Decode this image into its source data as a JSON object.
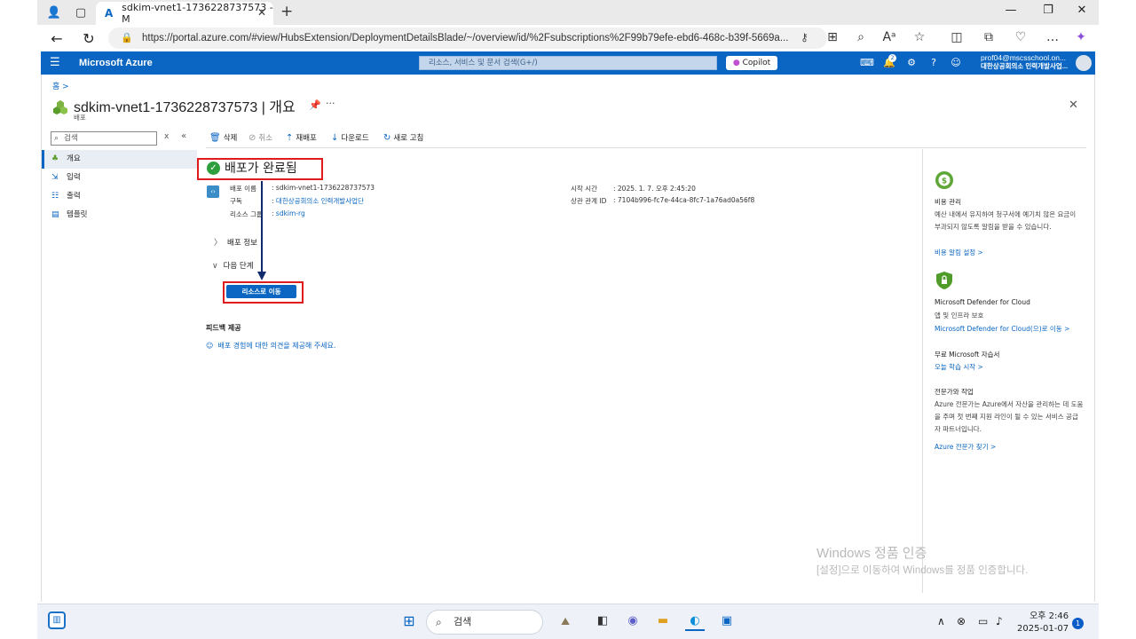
{
  "browser": {
    "tab_title": "sdkim-vnet1-1736228737573 - M",
    "url": "https://portal.azure.com/#view/HubsExtension/DeploymentDetailsBlade/~/overview/id/%2Fsubscriptions%2F99b79efe-ebd6-468c-b39f-5669a..."
  },
  "azure_header": {
    "brand": "Microsoft Azure",
    "search_placeholder": "리소스, 서비스 및 문서 검색(G+/)",
    "copilot_label": "Copilot",
    "notification_count": "2",
    "account_email": "prof04@mscsschool.on...",
    "account_org": "대한상공회의소 인력개발사업..."
  },
  "blade": {
    "breadcrumb": "홈 >",
    "title": "sdkim-vnet1-1736228737573 | 개요",
    "subtitle": "배포"
  },
  "sidebar": {
    "search_placeholder": "검색",
    "items": [
      {
        "label": "개요",
        "icon": "deployment-icon",
        "active": true
      },
      {
        "label": "입력",
        "icon": "input-icon",
        "active": false
      },
      {
        "label": "출력",
        "icon": "output-icon",
        "active": false
      },
      {
        "label": "템플릿",
        "icon": "template-icon",
        "active": false
      }
    ]
  },
  "commands": {
    "delete": "삭제",
    "cancel": "취소",
    "redeploy": "재배포",
    "download": "다운로드",
    "refresh": "새로 고침"
  },
  "deployment": {
    "status": "배포가 완료됨",
    "name_label": "배포 이름",
    "name_value": ": sdkim-vnet1-1736228737573",
    "subscription_label": "구독",
    "subscription_value": "대한상공회의소 인력개발사업단",
    "rg_label": "리소스 그룹",
    "rg_value": "sdkim-rg",
    "start_label": "시작 시간",
    "start_value": ": 2025. 1. 7. 오후 2:45:20",
    "corr_label": "상관 관계 ID",
    "corr_value": ": 7104b996-fc7e-44ca-8fc7-1a76ad0a56f8",
    "details_section": "배포 정보",
    "next_section": "다음 단계",
    "goto_button": "리소스로 이동",
    "feedback_title": "피드백 제공",
    "feedback_link": "배포 경험에 대한 의견을 제공해 주세요."
  },
  "right_pane": {
    "cost_title": "비용 관리",
    "cost_text": "예산 내에서 유지하여 청구서에 예기치 않은 요금이 부과되지 않도록 알림을 받을 수 있습니다.",
    "cost_link": "비용 알림 설정 >",
    "defender_title": "Microsoft Defender for Cloud",
    "defender_sub": "앱 및 인프라 보호",
    "defender_link": "Microsoft Defender for Cloud(으)로 이동 >",
    "tutorial_title": "무료 Microsoft 자습서",
    "tutorial_link": "오늘 학습 시작 >",
    "expert_title": "전문가와 작업",
    "expert_text": "Azure 전문가는 Azure에서 자산을 관리하는 데 도움을 주며 첫 번째 지원 라인이 될 수 있는 서비스 공급자 파트너입니다.",
    "expert_link": "Azure 전문가 찾기 >"
  },
  "watermark": {
    "line1": "Windows 정품 인증",
    "line2": "[설정]으로 이동하여 Windows를 정품 인증합니다."
  },
  "taskbar": {
    "search_label": "검색",
    "time": "오후 2:46",
    "date": "2025-01-07",
    "notif_count": "1"
  },
  "colors": {
    "azure_blue": "#0a66c2",
    "highlight_red": "#e01b1b",
    "success_green": "#2f9e3c",
    "arrow_navy": "#102a6e"
  }
}
